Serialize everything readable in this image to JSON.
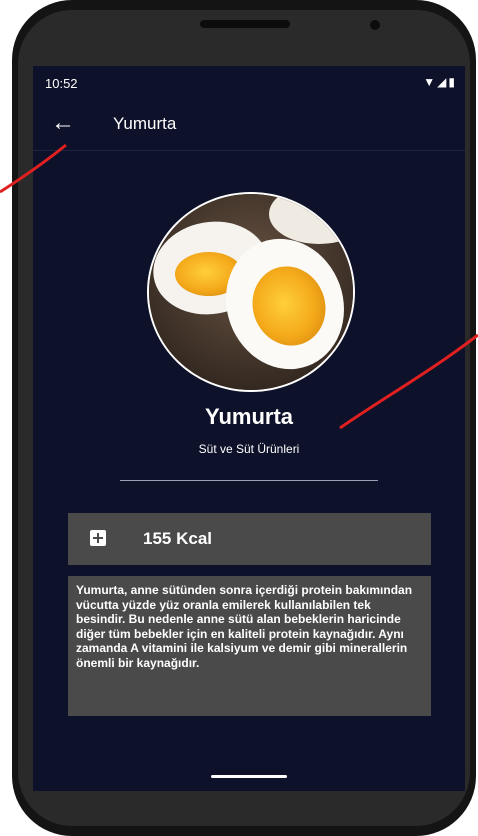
{
  "status_bar": {
    "time": "10:52",
    "icons_text": "▼◢▮"
  },
  "app_bar": {
    "back_icon": "arrow-left",
    "title": "Yumurta"
  },
  "food": {
    "name": "Yumurta",
    "category": "Süt ve Süt Ürünleri",
    "calories": "155 Kcal",
    "description": "Yumurta, anne sütünden sonra içerdiği protein bakımından vücutta yüzde yüz oranla emilerek kullanılabilen tek besindir. Bu nedenle anne sütü alan bebeklerin haricinde diğer tüm bebekler için en kaliteli protein kaynağıdır. Aynı zamanda A vitamini ile kalsiyum ve demir gibi minerallerin önemli bir kaynağıdır."
  },
  "colors": {
    "screen_bg": "#0d1129",
    "card_bg": "#4a4a4a",
    "annotation": "#e02020"
  }
}
